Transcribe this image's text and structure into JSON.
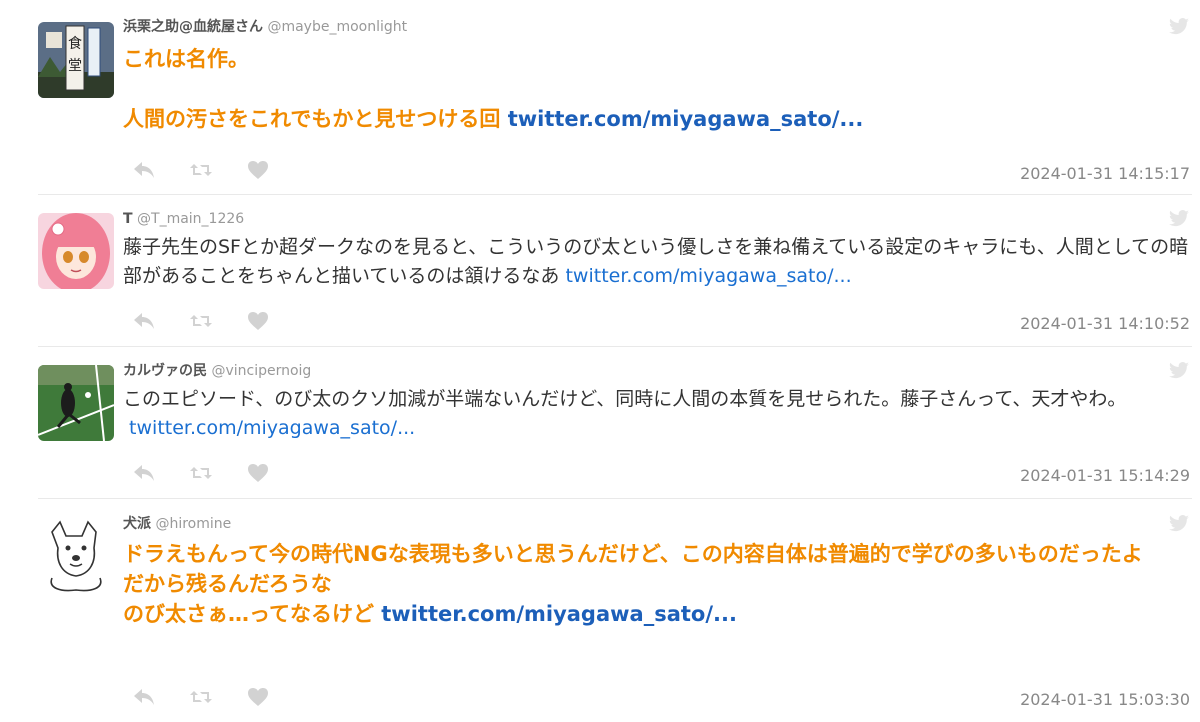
{
  "colors": {
    "highlight_text": "#f08a00",
    "link": "#1a6fd1",
    "timestamp": "#888888",
    "action_icon": "#cfcfcf"
  },
  "tweets": [
    {
      "name": "浜栗之助@血統屋さん",
      "handle": "@maybe_moonlight",
      "text_lines": [
        "これは名作。",
        "",
        "人間の汚さをこれでもかと見せつける回"
      ],
      "link": "twitter.com/miyagawa_sato/...",
      "timestamp": "2024-01-31 14:15:17",
      "highlighted": true
    },
    {
      "name": "T",
      "handle": "@T_main_1226",
      "text_lines": [
        "藤子先生のSFとか超ダークなのを見ると、こういうのび太という優しさを兼ね備えている設定のキャラにも、人間としての暗部があることをちゃんと描いているのは頷けるなあ"
      ],
      "link": "twitter.com/miyagawa_sato/...",
      "timestamp": "2024-01-31 14:10:52",
      "highlighted": false
    },
    {
      "name": "カルヴァの民",
      "handle": "@vincipernoig",
      "text_lines": [
        "このエピソード、のび太のクソ加減が半端ないんだけど、同時に人間の本質を見せられた。藤子さんって、天才やわ。"
      ],
      "link": "twitter.com/miyagawa_sato/...",
      "timestamp": "2024-01-31 15:14:29",
      "highlighted": false
    },
    {
      "name": "犬派",
      "handle": "@hiromine",
      "text_lines": [
        "ドラえもんって今の時代NGな表現も多いと思うんだけど、この内容自体は普遍的で学びの多いものだったよ",
        "だから残るんだろうな",
        "のび太さぁ…ってなるけど"
      ],
      "link": "twitter.com/miyagawa_sato/...",
      "timestamp": "2024-01-31 15:03:30",
      "highlighted": true
    }
  ]
}
